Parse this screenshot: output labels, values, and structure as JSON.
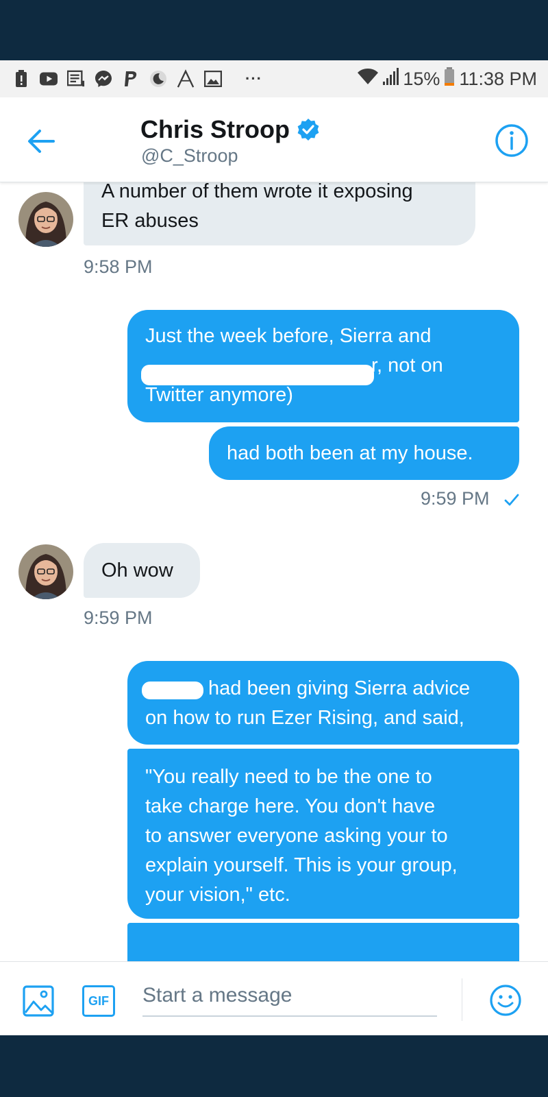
{
  "status_bar": {
    "battery_percent": "15%",
    "time": "11:38 PM",
    "notification_icons": [
      "alert-icon",
      "youtube-icon",
      "news-icon",
      "messenger-icon",
      "paypal-icon",
      "moon-icon",
      "aurora-icon",
      "gallery-icon"
    ],
    "more": "···"
  },
  "header": {
    "name": "Chris Stroop",
    "handle": "@C_Stroop",
    "verified": true
  },
  "messages": [
    {
      "dir": "in",
      "lines": [
        "A number of them wrote it exposing",
        "ER abuses"
      ]
    },
    {
      "time": "9:58 PM"
    },
    {
      "dir": "out",
      "lines": [
        "Just the week before, Sierra and",
        "r, not on",
        "Twitter anymore)"
      ]
    },
    {
      "dir": "out",
      "lines": [
        "had both been at my house."
      ]
    },
    {
      "time": "9:59 PM",
      "read": true
    },
    {
      "dir": "in",
      "lines": [
        "Oh wow"
      ]
    },
    {
      "time": "9:59 PM"
    },
    {
      "dir": "out",
      "lines": [
        "had been giving Sierra advice",
        "on how to run Ezer Rising, and said,"
      ]
    },
    {
      "dir": "out",
      "lines": [
        "\"You really need to be the one to",
        "take charge here. You don't have",
        "to answer everyone asking your to",
        "explain yourself. This is your group,",
        "your vision,\" etc."
      ]
    }
  ],
  "composer": {
    "placeholder": "Start a message",
    "gif_label": "GIF"
  },
  "colors": {
    "accent": "#1da1f2",
    "incoming_bubble": "#e6ecf0",
    "frame": "#0e2a40"
  }
}
